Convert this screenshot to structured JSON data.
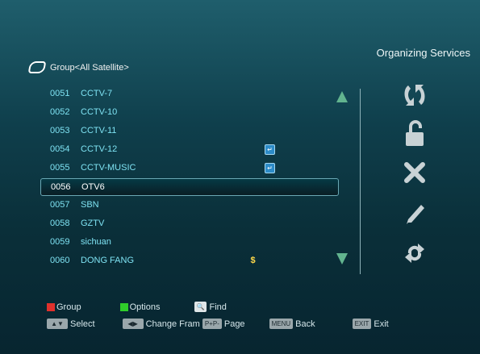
{
  "title": "Organizing Services",
  "group": "Group<All Satellite>",
  "channels": [
    {
      "num": "0051",
      "name": "CCTV-7",
      "tag": ""
    },
    {
      "num": "0052",
      "name": "CCTV-10",
      "tag": ""
    },
    {
      "num": "0053",
      "name": "CCTV-11",
      "tag": ""
    },
    {
      "num": "0054",
      "name": "CCTV-12",
      "tag": "lock"
    },
    {
      "num": "0055",
      "name": "CCTV-MUSIC",
      "tag": "lock"
    },
    {
      "num": "0056",
      "name": "OTV6",
      "tag": ""
    },
    {
      "num": "0057",
      "name": "SBN",
      "tag": ""
    },
    {
      "num": "0058",
      "name": "GZTV",
      "tag": ""
    },
    {
      "num": "0059",
      "name": "sichuan",
      "tag": ""
    },
    {
      "num": "0060",
      "name": "DONG FANG",
      "tag": "dollar"
    }
  ],
  "selected_index": 5,
  "tag_symbols": {
    "lock": "↵",
    "dollar": "$"
  },
  "side_icons": [
    "sort-icon",
    "unlock-icon",
    "delete-icon",
    "edit-icon",
    "move-icon"
  ],
  "footer": {
    "red_label": "Group",
    "green_label": "Options",
    "find_label": "Find",
    "select_label": "Select",
    "change_label": "Change Fram",
    "pp_key": "P+P-",
    "page_label": "Page",
    "menu_key": "MENU",
    "back_label": "Back",
    "exit_key": "EXIT",
    "exit_label": "Exit"
  },
  "colors": {
    "red": "#e0312c",
    "green": "#2fce2a",
    "channel_text": "#7ee2f2"
  }
}
